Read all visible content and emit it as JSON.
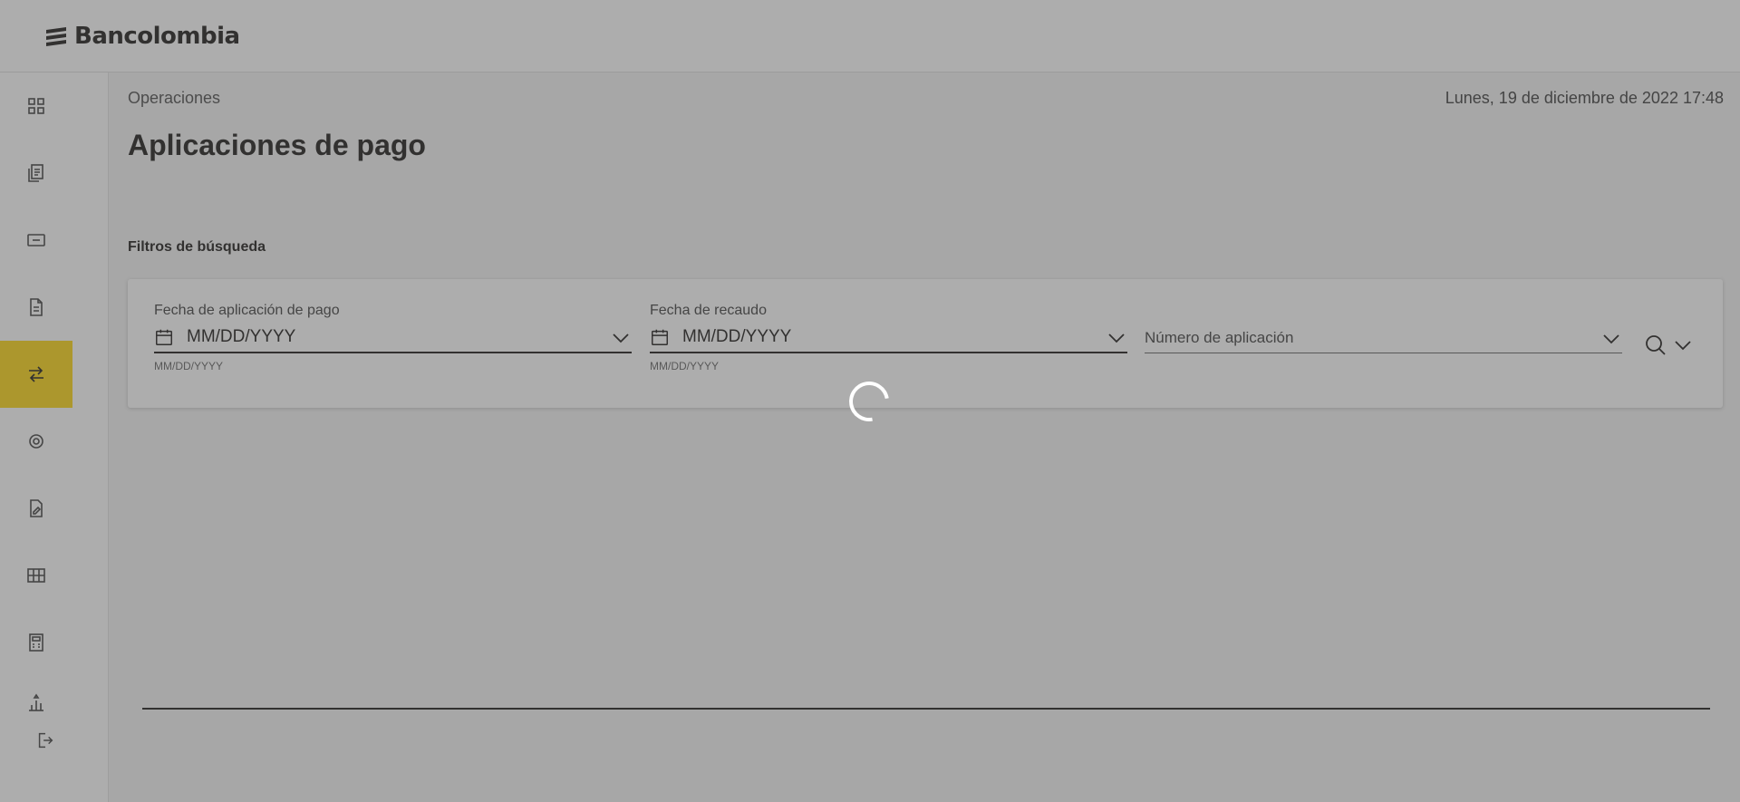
{
  "brand": {
    "name": "Bancolombia"
  },
  "sidebar": {
    "items": [
      {
        "icon": "dashboard-icon",
        "active": false
      },
      {
        "icon": "documents-icon",
        "active": false
      },
      {
        "icon": "card-icon",
        "active": false
      },
      {
        "icon": "file-stack-icon",
        "active": false
      },
      {
        "icon": "transfer-arrows-icon",
        "active": true
      },
      {
        "icon": "gear-icon",
        "active": false
      },
      {
        "icon": "document-edit-icon",
        "active": false
      },
      {
        "icon": "grid-report-icon",
        "active": false
      },
      {
        "icon": "calculator-icon",
        "active": false
      },
      {
        "icon": "stats-icon",
        "active": false
      },
      {
        "icon": "logout-icon",
        "active": false
      }
    ]
  },
  "header": {
    "breadcrumb": "Operaciones",
    "datetime": "Lunes, 19 de diciembre de 2022 17:48",
    "title": "Aplicaciones de pago"
  },
  "filters": {
    "section_label": "Filtros de búsqueda",
    "payment_date": {
      "label": "Fecha de aplicación de pago",
      "placeholder": "MM/DD/YYYY",
      "hint": "MM/DD/YYYY"
    },
    "collection_date": {
      "label": "Fecha de recaudo",
      "placeholder": "MM/DD/YYYY",
      "hint": "MM/DD/YYYY"
    },
    "application_number": {
      "placeholder": "Número de aplicación"
    }
  },
  "overlay": {
    "state": "loading"
  },
  "colors": {
    "accent": "#fdda24",
    "text": "#2c2a29",
    "background": "#f4f4f4"
  }
}
